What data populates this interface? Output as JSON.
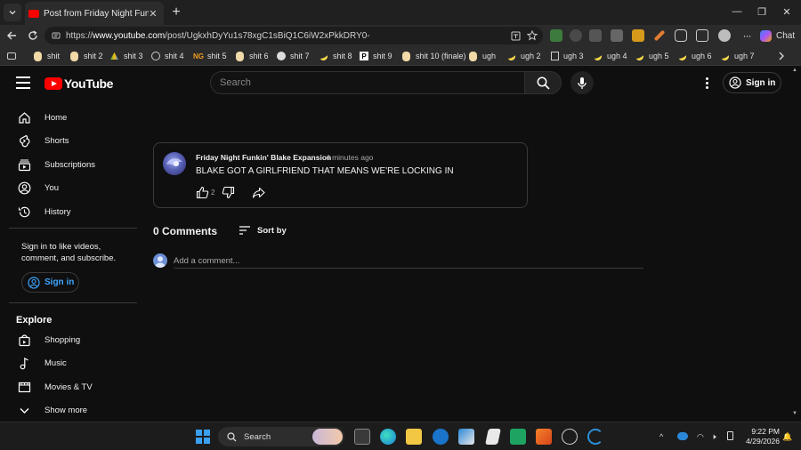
{
  "browser": {
    "tab_title": "Post from Friday Night Funkin' Blake Expansion",
    "url_prefix": "https://",
    "url_host": "www.youtube.com",
    "url_path": "/post/UgkxhDyYu1s78xgC1sBiQ1C6iW2xPkkDRY0-",
    "chat_label": "Chat",
    "bookmarks": [
      "shit",
      "shit 2",
      "shit 3",
      "shit 4",
      "shit 5",
      "shit 6",
      "shit 7",
      "shit 8",
      "shit 9",
      "shit 10 (finale)",
      "ugh",
      "ugh 2",
      "ugh 3",
      "ugh 4",
      "ugh 5",
      "ugh 6",
      "ugh 7"
    ]
  },
  "youtube": {
    "wordmark": "YouTube",
    "search_placeholder": "Search",
    "signin_label": "Sign in",
    "sidebar": {
      "items": [
        "Home",
        "Shorts",
        "Subscriptions",
        "You",
        "History"
      ],
      "signin_message": "Sign in to like videos, comment, and subscribe.",
      "signin_label": "Sign in",
      "explore_title": "Explore",
      "explore_items": [
        "Shopping",
        "Music",
        "Movies & TV",
        "Show more"
      ]
    },
    "post": {
      "author": "Friday Night Funkin' Blake Expansion",
      "time": "4 minutes ago",
      "text": "BLAKE GOT A GIRLFRIEND THAT MEANS WE'RE LOCKING IN",
      "likes": "2"
    },
    "comments": {
      "count_label": "0 Comments",
      "sort_label": "Sort by",
      "add_placeholder": "Add a comment..."
    }
  },
  "taskbar": {
    "search_label": "Search",
    "time": "9:22 PM",
    "date": "4/29/2026"
  },
  "colors": {
    "youtube_red": "#ff0000",
    "link_blue": "#3ea6ff",
    "page_bg": "#0f0f0f"
  }
}
